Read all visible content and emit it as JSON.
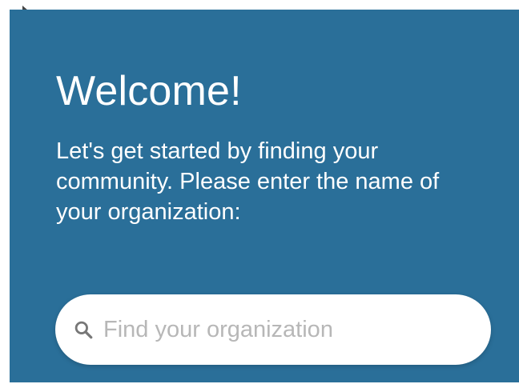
{
  "colors": {
    "panel_background": "#2a6f99",
    "text": "#ffffff",
    "placeholder": "#b7b7b7",
    "search_background": "#ffffff",
    "icon": "#777777"
  },
  "welcome": {
    "title": "Welcome!",
    "message": "Let's get started by finding your community. Please enter the name of your organization:"
  },
  "search": {
    "placeholder": "Find your organization",
    "value": "",
    "icon": "search-icon"
  }
}
